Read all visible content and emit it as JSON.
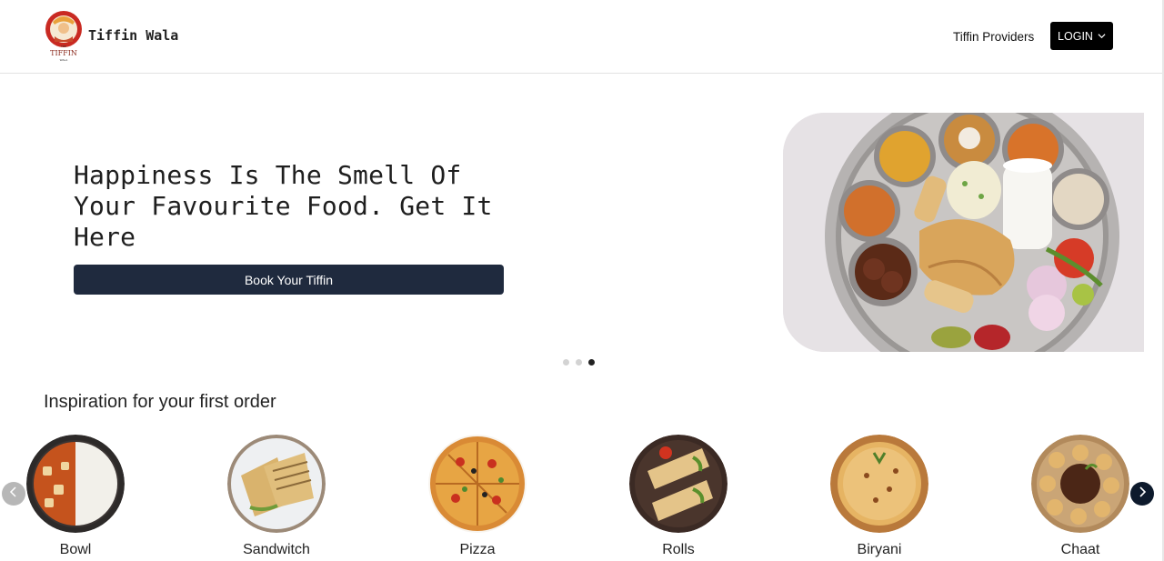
{
  "header": {
    "brand": "Tiffin Wala",
    "logo_text": "THE TIFFIN WALA",
    "nav_link": "Tiffin Providers",
    "login_label": "LOGIN"
  },
  "hero": {
    "headline": "Happiness Is The Smell Of Your Favourite Food. Get It Here",
    "cta_label": "Book Your Tiffin",
    "image": "thali-plate",
    "carousel_slide": 3,
    "carousel_total": 3
  },
  "inspiration": {
    "title": "Inspiration for your first order",
    "items": [
      {
        "label": "Bowl"
      },
      {
        "label": "Sandwitch"
      },
      {
        "label": "Pizza"
      },
      {
        "label": "Rolls"
      },
      {
        "label": "Biryani"
      },
      {
        "label": "Chaat"
      }
    ]
  },
  "colors": {
    "login_bg": "#000000",
    "cta_bg": "#1f2a3e",
    "next_arrow_bg": "#0d1a2c",
    "prev_arrow_bg": "#b7b7b7"
  },
  "icons": [
    "chevron-down-icon",
    "chevron-left-icon",
    "chevron-right-icon"
  ]
}
